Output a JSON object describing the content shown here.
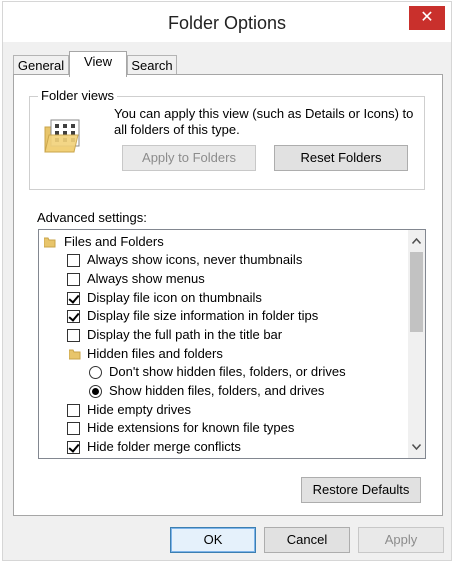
{
  "window": {
    "title": "Folder Options",
    "close_label": "✕"
  },
  "tabs": [
    {
      "label": "General",
      "active": false
    },
    {
      "label": "View",
      "active": true
    },
    {
      "label": "Search",
      "active": false
    }
  ],
  "folder_views": {
    "legend": "Folder views",
    "description": "You can apply this view (such as Details or Icons) to all folders of this type.",
    "apply_label": "Apply to Folders",
    "reset_label": "Reset Folders"
  },
  "advanced": {
    "label": "Advanced settings:",
    "items": [
      {
        "type": "folder",
        "label": "Files and Folders"
      },
      {
        "type": "checkbox",
        "label": "Always show icons, never thumbnails",
        "checked": false
      },
      {
        "type": "checkbox",
        "label": "Always show menus",
        "checked": false
      },
      {
        "type": "checkbox",
        "label": "Display file icon on thumbnails",
        "checked": true
      },
      {
        "type": "checkbox",
        "label": "Display file size information in folder tips",
        "checked": true
      },
      {
        "type": "checkbox",
        "label": "Display the full path in the title bar",
        "checked": false
      },
      {
        "type": "folder",
        "label": "Hidden files and folders"
      },
      {
        "type": "radio",
        "label": "Don't show hidden files, folders, or drives",
        "selected": false
      },
      {
        "type": "radio",
        "label": "Show hidden files, folders, and drives",
        "selected": true
      },
      {
        "type": "checkbox",
        "label": "Hide empty drives",
        "checked": false
      },
      {
        "type": "checkbox",
        "label": "Hide extensions for known file types",
        "checked": false
      },
      {
        "type": "checkbox",
        "label": "Hide folder merge conflicts",
        "checked": true
      }
    ],
    "restore_label": "Restore Defaults"
  },
  "footer": {
    "ok_label": "OK",
    "cancel_label": "Cancel",
    "apply_label": "Apply"
  },
  "icons": {
    "close": "close-icon",
    "folder": "folder-icon",
    "folder_view": "folder-view-icon",
    "scroll_up": "scroll-up-icon",
    "scroll_down": "scroll-down-icon"
  },
  "colors": {
    "close_button": "#c9302c",
    "window_bg": "#f0f0f0",
    "focus_border": "#3c7fb1"
  }
}
